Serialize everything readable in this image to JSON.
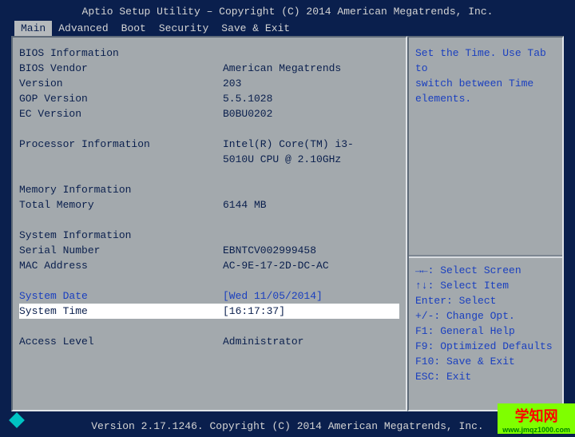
{
  "header": {
    "title": "Aptio Setup Utility – Copyright (C) 2014 American Megatrends, Inc."
  },
  "tabs": [
    "Main",
    "Advanced",
    "Boot",
    "Security",
    "Save & Exit"
  ],
  "active_tab": 0,
  "info": {
    "bios_info_header": "BIOS Information",
    "bios_vendor_label": "BIOS Vendor",
    "bios_vendor_value": "American Megatrends",
    "version_label": "Version",
    "version_value": "203",
    "gop_version_label": "GOP Version",
    "gop_version_value": "5.5.1028",
    "ec_version_label": "EC Version",
    "ec_version_value": "B0BU0202",
    "processor_info_label": "Processor Information",
    "processor_info_value1": "Intel(R) Core(TM) i3-",
    "processor_info_value2": "5010U CPU @ 2.10GHz",
    "memory_info_header": "Memory Information",
    "total_memory_label": "Total Memory",
    "total_memory_value": "6144 MB",
    "system_info_header": "System Information",
    "serial_number_label": "Serial Number",
    "serial_number_value": "EBNTCV002999458",
    "mac_address_label": "MAC Address",
    "mac_address_value": "AC-9E-17-2D-DC-AC",
    "system_date_label": "System Date",
    "system_date_value": "[Wed 11/05/2014]",
    "system_time_label": "System Time",
    "system_time_value": "[16:17:37]",
    "access_level_label": "Access Level",
    "access_level_value": "Administrator"
  },
  "help": {
    "line1": "Set the Time. Use Tab to",
    "line2": "switch between Time elements."
  },
  "keys": {
    "k1": "→←: Select Screen",
    "k2": "↑↓: Select Item",
    "k3": "Enter: Select",
    "k4": "+/-: Change Opt.",
    "k5": "F1: General Help",
    "k6": "F9: Optimized Defaults",
    "k7": "F10: Save & Exit",
    "k8": "ESC: Exit"
  },
  "footer": {
    "text": "Version 2.17.1246. Copyright (C) 2014 American Megatrends, Inc."
  },
  "watermark": {
    "main": "学知网",
    "sub": "www.jmqz1000.com"
  }
}
